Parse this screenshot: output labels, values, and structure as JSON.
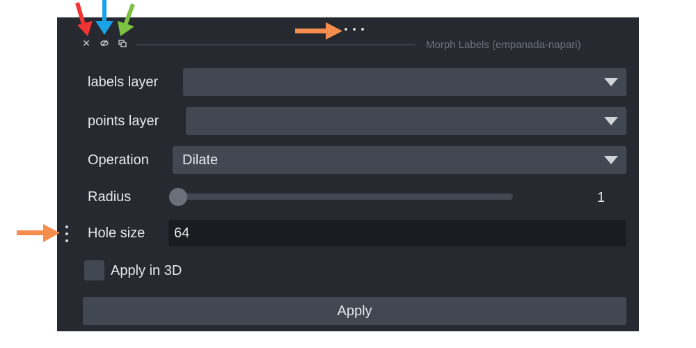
{
  "window": {
    "title": "Morph Labels (empanada-napari)",
    "close_glyph": "✕",
    "icons": [
      "close-icon",
      "hide-icon",
      "float-icon",
      "more-options-icon",
      "drag-handle-icon"
    ]
  },
  "form": {
    "labels_layer": {
      "label": "labels layer",
      "value": ""
    },
    "points_layer": {
      "label": "points layer",
      "value": ""
    },
    "operation": {
      "label": "Operation",
      "value": "Dilate"
    },
    "radius": {
      "label": "Radius",
      "value": "1",
      "level": 0.0
    },
    "hole_size": {
      "label": "Hole size",
      "value": "64"
    },
    "apply_3d": {
      "label": "Apply in 3D",
      "checked": false
    },
    "apply_button": "Apply"
  },
  "annotation_colors": {
    "red": "#f23434",
    "blue": "#1aa2e8",
    "green": "#7cc142",
    "orange": "#f58d4e"
  },
  "colors": {
    "panel_bg": "#262930",
    "widget_bg": "#414852",
    "input_bg": "#191c20",
    "text": "#e6e8ea"
  }
}
